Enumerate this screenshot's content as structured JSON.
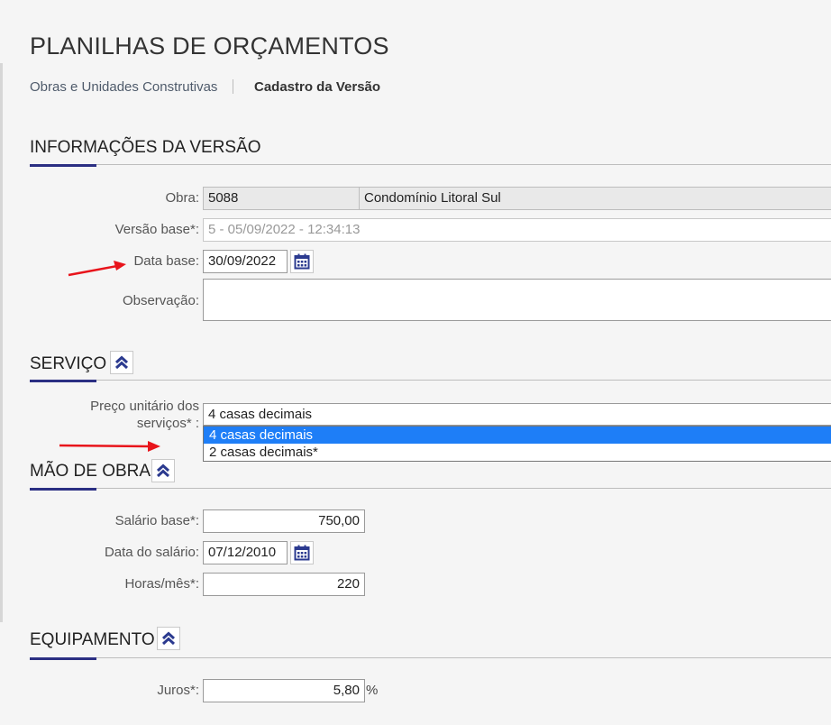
{
  "page": {
    "title": "PLANILHAS DE ORÇAMENTOS",
    "breadcrumb": {
      "link": "Obras e Unidades Construtivas",
      "current": "Cadastro da Versão"
    }
  },
  "versao": {
    "section_title": "INFORMAÇÕES DA VERSÃO",
    "obra_label": "Obra:",
    "obra_code": "5088",
    "obra_name": "Condomínio Litoral Sul",
    "versao_base_label": "Versão base*:",
    "versao_base_value": "5 - 05/09/2022 - 12:34:13",
    "data_base_label": "Data base:",
    "data_base_value": "30/09/2022",
    "observacao_label": "Observação:",
    "observacao_value": ""
  },
  "servico": {
    "section_title": "SERVIÇO",
    "preco_label_line1": "Preço unitário dos",
    "preco_label_line2": "serviços* :",
    "preco_selected": "4 casas decimais",
    "options": [
      "4 casas decimais",
      "2 casas decimais*"
    ],
    "highlighted_option": "4 casas decimais"
  },
  "mao_de_obra": {
    "section_title": "MÃO DE OBRA",
    "salario_base_label": "Salário base*:",
    "salario_base_value": "750,00",
    "data_salario_label": "Data do salário:",
    "data_salario_value": "07/12/2010",
    "horas_mes_label": "Horas/mês*:",
    "horas_mes_value": "220"
  },
  "equipamento": {
    "section_title": "EQUIPAMENTO",
    "juros_label": "Juros*:",
    "juros_value": "5,80",
    "juros_unit": "%"
  },
  "colors": {
    "accent": "#2b2f83",
    "highlight": "#1e7ef7",
    "arrow": "#e8141b",
    "icon": "#2b3a8f"
  }
}
